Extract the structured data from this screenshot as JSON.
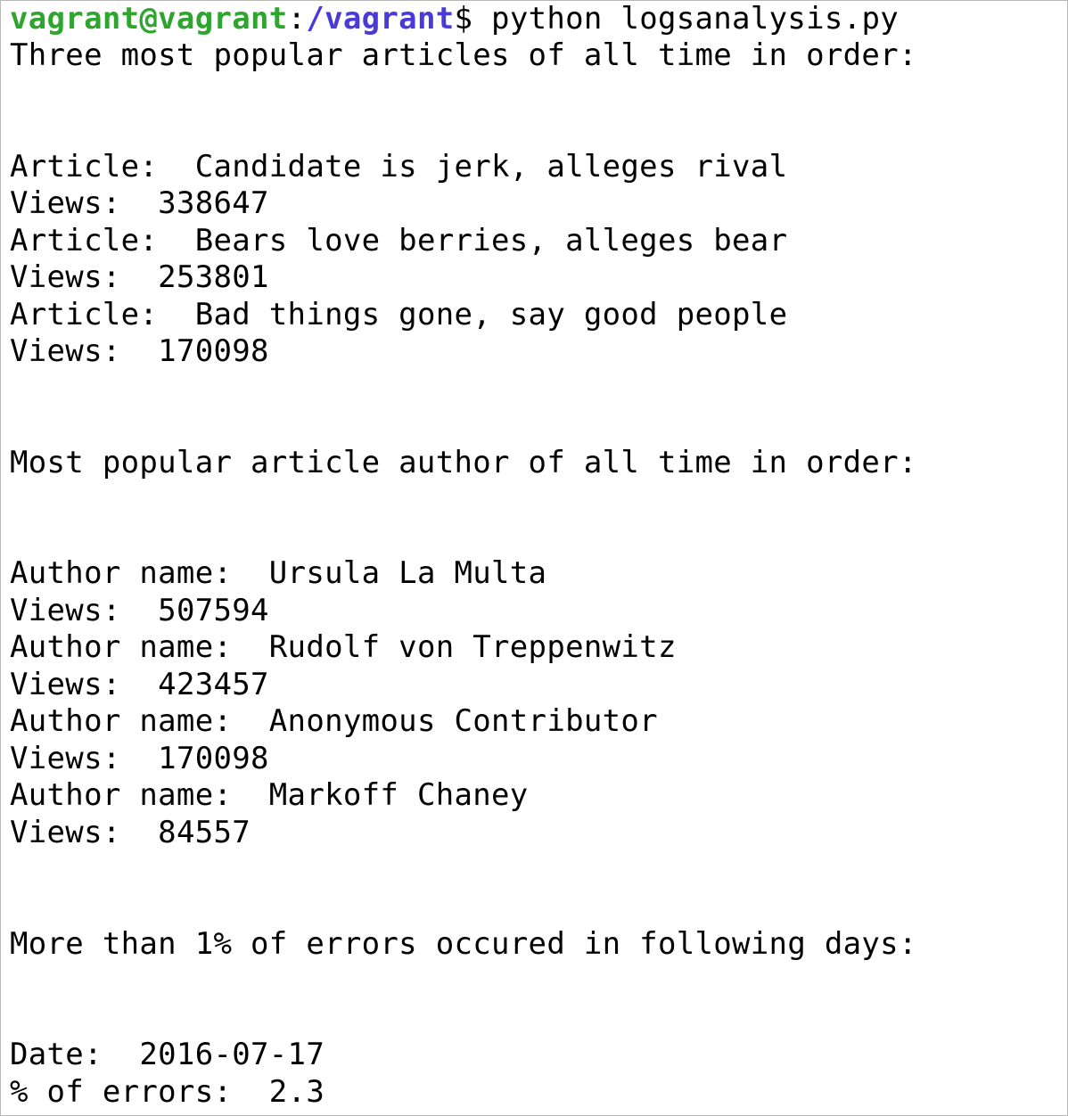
{
  "prompt": {
    "user_host": "vagrant@vagrant",
    "separator": ":",
    "path": "/vagrant",
    "symbol": "$",
    "command": " python logsanalysis.py"
  },
  "articles_section": {
    "heading": "Three most popular articles of all time in order:",
    "items": [
      {
        "label": "Article:  ",
        "title": "Candidate is jerk, alleges rival",
        "views_label": "Views:  ",
        "views": "338647"
      },
      {
        "label": "Article:  ",
        "title": "Bears love berries, alleges bear",
        "views_label": "Views:  ",
        "views": "253801"
      },
      {
        "label": "Article:  ",
        "title": "Bad things gone, say good people",
        "views_label": "Views:  ",
        "views": "170098"
      }
    ]
  },
  "authors_section": {
    "heading": "Most popular article author of all time in order:",
    "items": [
      {
        "label": "Author name:  ",
        "name": "Ursula La Multa",
        "views_label": "Views:  ",
        "views": "507594"
      },
      {
        "label": "Author name:  ",
        "name": "Rudolf von Treppenwitz",
        "views_label": "Views:  ",
        "views": "423457"
      },
      {
        "label": "Author name:  ",
        "name": "Anonymous Contributor",
        "views_label": "Views:  ",
        "views": "170098"
      },
      {
        "label": "Author name:  ",
        "name": "Markoff Chaney",
        "views_label": "Views:  ",
        "views": "84557"
      }
    ]
  },
  "errors_section": {
    "heading": "More than 1% of errors occured in following days:",
    "date_label": "Date:  ",
    "date": "2016-07-17",
    "pct_label": "% of errors:  ",
    "pct": "2.3"
  },
  "colors": {
    "user_host": "#2fa52f",
    "path": "#4a3ad8",
    "text": "#000000",
    "background": "#ffffff"
  }
}
